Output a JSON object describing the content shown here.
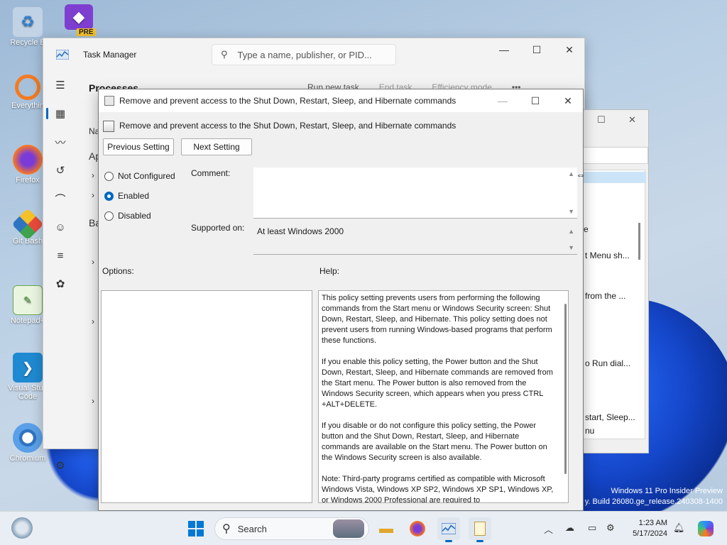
{
  "colors": {
    "accent": "#0067c0",
    "dialog_bg": "#f0f0f0",
    "taskbar": "#e9eef4"
  },
  "desktop": {
    "icons": [
      {
        "label": "Recycle Bin",
        "short": "Recycle B",
        "icon": "recycle-bin-icon"
      },
      {
        "label": "Everything",
        "short": "Everythin",
        "icon": "everything-search-icon"
      },
      {
        "label": "Firefox",
        "short": "Firefox",
        "icon": "firefox-icon"
      },
      {
        "label": "Git Bash",
        "short": "Git Bash",
        "icon": "git-bash-icon"
      },
      {
        "label": "Notepad++",
        "short": "Notepad+",
        "icon": "notepad-plus-icon"
      },
      {
        "label": "Visual Studio Code",
        "short": "Visual Stud Code",
        "icon": "vscode-icon"
      },
      {
        "label": "Chromium",
        "short": "Chromium",
        "icon": "chromium-icon"
      }
    ],
    "vs_pre_badge": "PRE",
    "watermark_line1": "Windows 11 Pro Insider Preview",
    "watermark_line2": "y. Build 26080.ge_release.240308-1400"
  },
  "task_manager": {
    "title": "Task Manager",
    "search_placeholder": "Type a name, publisher, or PID...",
    "section": "Processes",
    "toolbar": {
      "run_new_task": "Run new task",
      "end_task": "End task",
      "efficiency_mode": "Efficiency mode",
      "more": "•••"
    },
    "partial": {
      "na": "Na",
      "ap": "Ap",
      "ba": "Ba"
    }
  },
  "bg_window": {
    "rows": [
      "e",
      "t Menu sh...",
      "from the ...",
      "o Run dial...",
      "start, Sleep...",
      "nu"
    ]
  },
  "dialog": {
    "title": "Remove and prevent access to the Shut Down, Restart, Sleep, and Hibernate commands",
    "heading": "Remove and prevent access to the Shut Down, Restart, Sleep, and Hibernate commands",
    "prev_button": "Previous Setting",
    "next_button": "Next Setting",
    "radios": [
      {
        "label": "Not Configured",
        "checked": false
      },
      {
        "label": "Enabled",
        "checked": true
      },
      {
        "label": "Disabled",
        "checked": false
      }
    ],
    "comment_label": "Comment:",
    "comment_value": "",
    "supported_label": "Supported on:",
    "supported_value": "At least Windows 2000",
    "options_label": "Options:",
    "help_label": "Help:",
    "help_text": "This policy setting prevents users from performing the following commands from the Start menu or Windows Security screen: Shut Down, Restart, Sleep, and Hibernate. This policy setting does not prevent users from running Windows-based programs that perform these functions.\n\nIf you enable this policy setting, the Power button and the Shut Down, Restart, Sleep, and Hibernate commands are removed from the Start menu. The Power button is also removed from the Windows Security screen, which appears when you press CTRL +ALT+DELETE.\n\nIf you disable or do not configure this policy setting, the Power button and the Shut Down, Restart, Sleep, and Hibernate commands are available on the Start menu. The Power button on the Windows Security screen is also available.\n\nNote: Third-party programs certified as compatible with Microsoft Windows Vista, Windows XP SP2, Windows XP SP1, Windows XP, or Windows 2000 Professional are required to"
  },
  "taskbar": {
    "search_label": "Search",
    "time": "1:23 AM",
    "date": "5/17/2024"
  }
}
